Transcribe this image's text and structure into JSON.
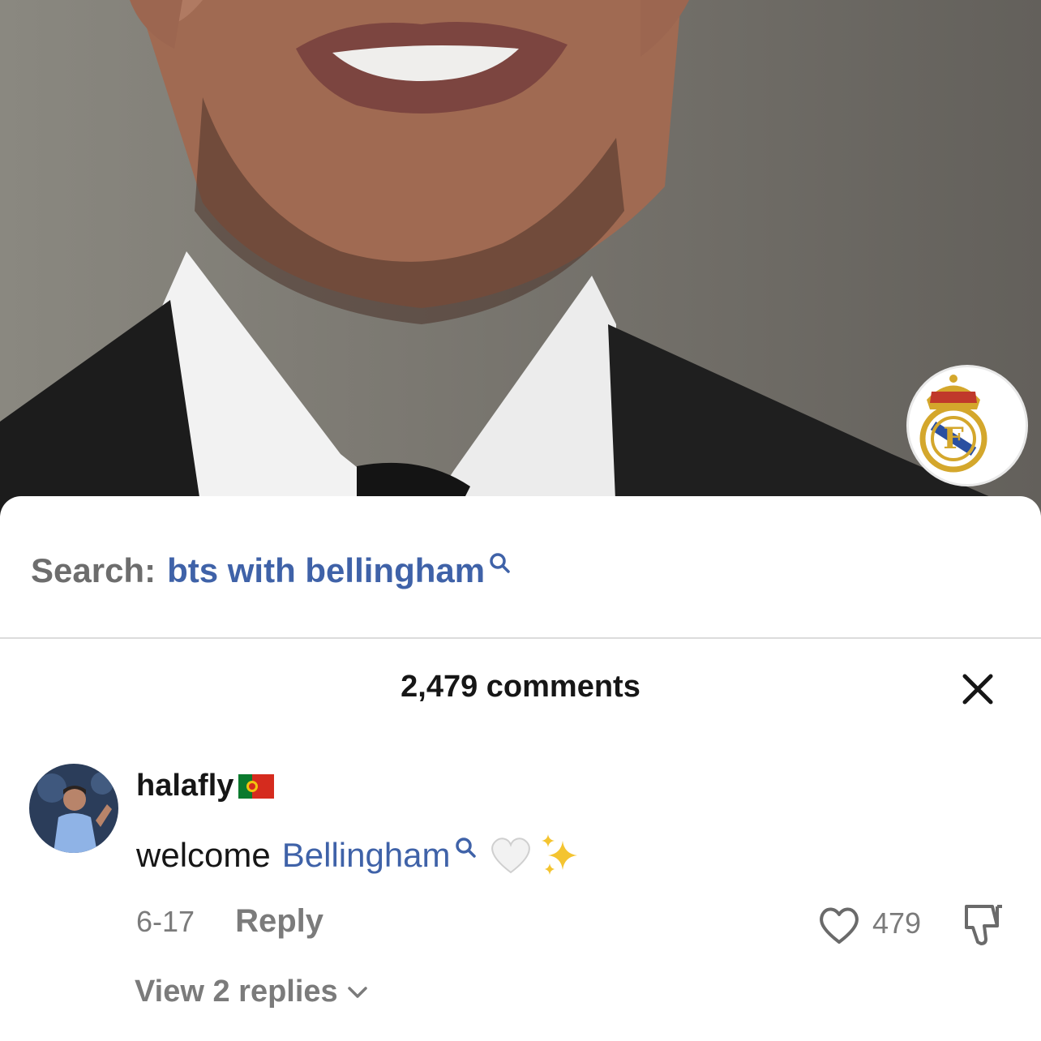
{
  "search": {
    "prefix": "Search:",
    "query": "bts with bellingham"
  },
  "comments_header": {
    "count_label": "2,479 comments"
  },
  "comment": {
    "username": "halafly",
    "text_prefix": "welcome",
    "mention": "Bellingham",
    "date": "6-17",
    "reply_label": "Reply",
    "like_count": "479",
    "view_replies_label": "View 2 replies"
  },
  "icons": {
    "creator_avatar": "real-madrid-crest-icon",
    "search_hint": "search-icon",
    "close": "close-icon",
    "flag": "portugal-flag-icon",
    "heart_emoji": "white-heart-icon",
    "sparkles_emoji": "sparkles-icon",
    "like": "heart-outline-icon",
    "dislike": "thumbs-down-icon",
    "expand": "chevron-down-icon"
  },
  "colors": {
    "link_blue": "#3f62a8",
    "meta_gray": "#7b7b7b",
    "text_dark": "#161616"
  }
}
